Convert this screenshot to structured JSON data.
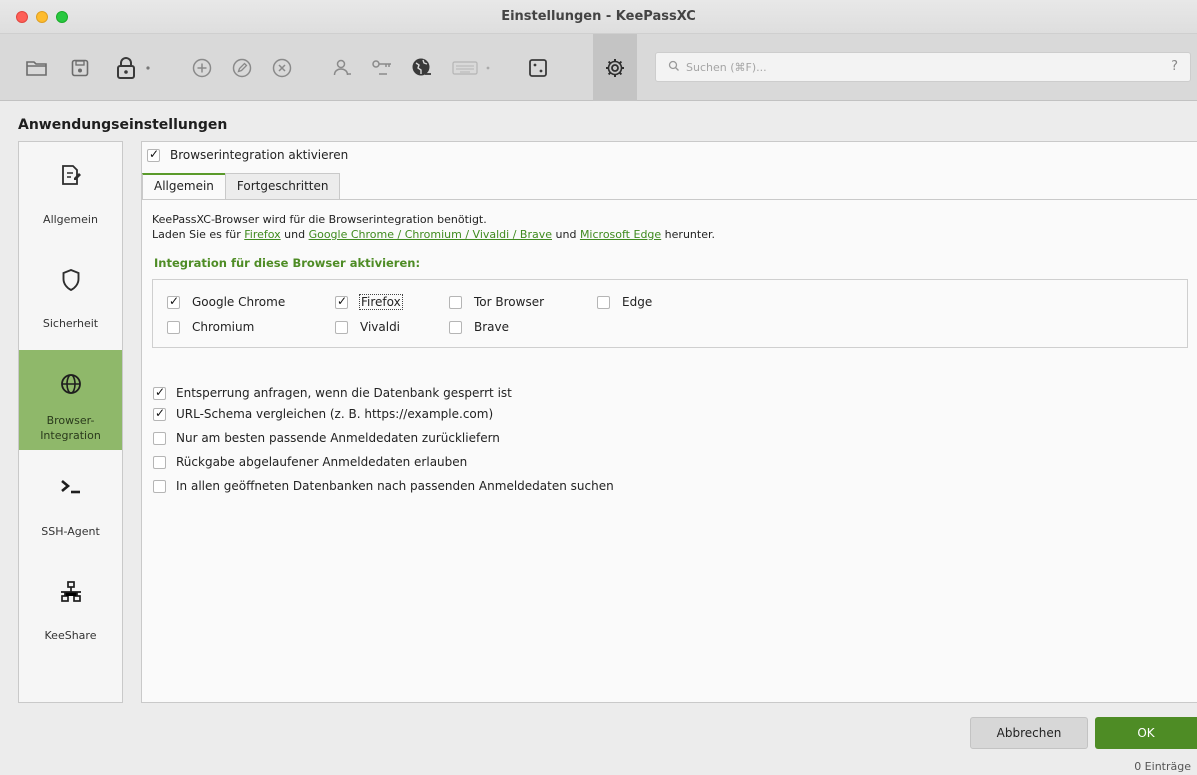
{
  "window": {
    "title": "Einstellungen - KeePassXC"
  },
  "toolbar": {
    "buttons": [
      {
        "name": "open-database",
        "icon": "folder-icon"
      },
      {
        "name": "save-database",
        "icon": "save-icon"
      },
      {
        "name": "lock-database",
        "icon": "lock-icon"
      },
      {
        "name": "add-entry",
        "icon": "plus-circle-icon"
      },
      {
        "name": "edit-entry",
        "icon": "pencil-circle-icon"
      },
      {
        "name": "delete-entry",
        "icon": "x-circle-icon"
      },
      {
        "name": "copy-username",
        "icon": "user-icon"
      },
      {
        "name": "copy-password",
        "icon": "key-icon"
      },
      {
        "name": "copy-url",
        "icon": "globe-icon"
      },
      {
        "name": "autotype",
        "icon": "keyboard-icon"
      },
      {
        "name": "password-generator",
        "icon": "dice-icon"
      },
      {
        "name": "settings",
        "icon": "gear-icon",
        "active": true
      }
    ],
    "search_placeholder": "Suchen (⌘F)...",
    "help_label": "?"
  },
  "page": {
    "section_title": "Anwendungseinstellungen"
  },
  "categories": [
    {
      "label": "Allgemein",
      "icon": "document-pencil-icon",
      "active": false
    },
    {
      "label": "Sicherheit",
      "icon": "shield-icon",
      "active": false
    },
    {
      "label": "Browser-\nIntegration",
      "icon": "globe-icon",
      "active": true
    },
    {
      "label": "SSH-Agent",
      "icon": "terminal-icon",
      "active": false
    },
    {
      "label": "KeeShare",
      "icon": "network-icon",
      "active": false
    }
  ],
  "browser_integration": {
    "enable_label": "Browserintegration aktivieren",
    "enabled": true,
    "tabs": [
      {
        "label": "Allgemein",
        "active": true
      },
      {
        "label": "Fortgeschritten",
        "active": false
      }
    ],
    "desc_line1": "KeePassXC-Browser wird für die Browserintegration benötigt.",
    "desc_line2_prefix": "Laden Sie es für ",
    "link_firefox": "Firefox",
    "desc_und1": " und ",
    "link_chrome": "Google Chrome / Chromium / Vivaldi / Brave",
    "desc_und2": " und ",
    "link_edge": "Microsoft Edge",
    "desc_suffix": " herunter.",
    "browsers_heading": "Integration für diese Browser aktivieren:",
    "browsers": [
      {
        "label": "Google Chrome",
        "checked": true
      },
      {
        "label": "Firefox",
        "checked": true
      },
      {
        "label": "Tor Browser",
        "checked": false
      },
      {
        "label": "Edge",
        "checked": false
      },
      {
        "label": "Chromium",
        "checked": false
      },
      {
        "label": "Vivaldi",
        "checked": false
      },
      {
        "label": "Brave",
        "checked": false
      }
    ],
    "options": [
      {
        "label": "Entsperrung anfragen, wenn die Datenbank gesperrt ist",
        "checked": true
      },
      {
        "label": "URL-Schema vergleichen (z. B. https://example.com)",
        "checked": true
      },
      {
        "label": "Nur am besten passende Anmeldedaten zurückliefern",
        "checked": false
      },
      {
        "label": "Rückgabe abgelaufener Anmeldedaten erlauben",
        "checked": false
      },
      {
        "label": "In allen geöffneten Datenbanken nach passenden Anmeldedaten suchen",
        "checked": false
      }
    ]
  },
  "footer": {
    "cancel_label": "Abbrechen",
    "ok_label": "OK",
    "status": "0 Einträge"
  }
}
